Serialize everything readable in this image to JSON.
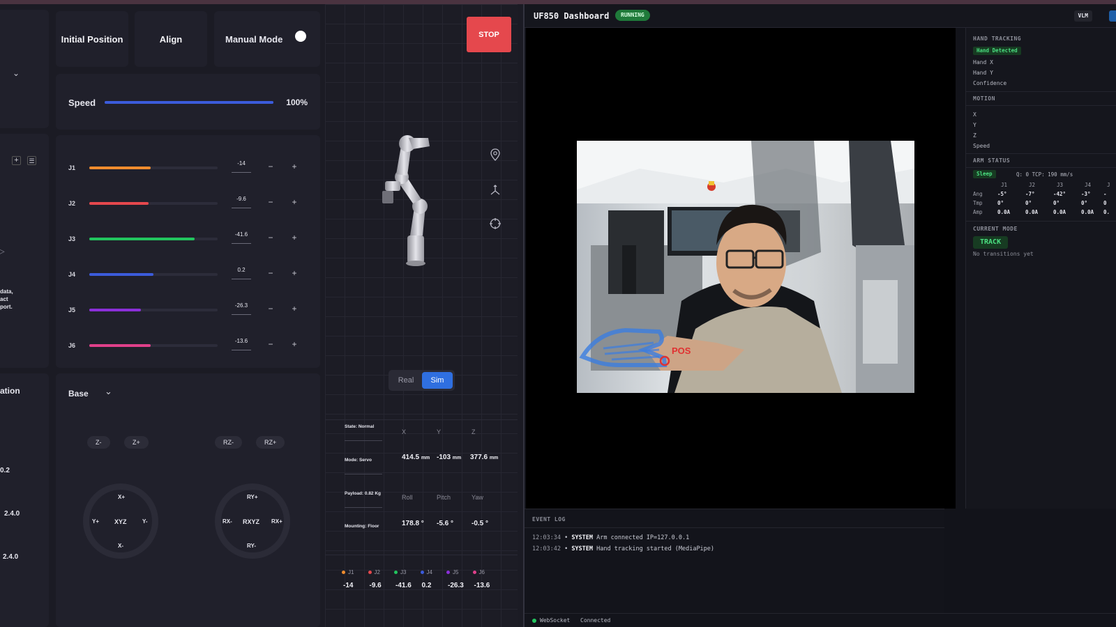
{
  "left_panel": {
    "partial_texts": {
      "dataset_note_lines": [
        "data,",
        "act",
        "port."
      ],
      "section_partial": "ation",
      "version_values": [
        "0.2",
        "2.4.0",
        "2.4.0"
      ]
    },
    "top_buttons": {
      "initial_position": "Initial Position",
      "align": "Align",
      "manual_mode": "Manual Mode"
    },
    "stop": "STOP",
    "speed": {
      "label": "Speed",
      "value_text": "100%",
      "fraction": 1.0
    },
    "joints": [
      {
        "id": "J1",
        "value": "-14",
        "fill": 0.48,
        "color": "#f08c2e"
      },
      {
        "id": "J2",
        "value": "-9.6",
        "fill": 0.46,
        "color": "#e5484d"
      },
      {
        "id": "J3",
        "value": "-41.6",
        "fill": 0.82,
        "color": "#22c55e"
      },
      {
        "id": "J4",
        "value": "0.2",
        "fill": 0.5,
        "color": "#3b5bdb"
      },
      {
        "id": "J5",
        "value": "-26.3",
        "fill": 0.4,
        "color": "#8b2fd9"
      },
      {
        "id": "J6",
        "value": "-13.6",
        "fill": 0.48,
        "color": "#e0408a"
      }
    ],
    "step_minus": "−",
    "step_plus": "+",
    "frame": {
      "label": "Base"
    },
    "jog": {
      "z_minus": "Z-",
      "z_plus": "Z+",
      "rz_minus": "RZ-",
      "rz_plus": "RZ+",
      "xyz": {
        "center": "XYZ",
        "top": "X+",
        "bottom": "X-",
        "left": "Y+",
        "right": "Y-"
      },
      "rxyz": {
        "center": "RXYZ",
        "top": "RY+",
        "bottom": "RY-",
        "left": "RX-",
        "right": "RX+"
      }
    }
  },
  "viz": {
    "mode_toggle": {
      "real": "Real",
      "sim": "Sim",
      "active": "Sim"
    },
    "info": {
      "state": "State: Normal",
      "mode": "Mode: Servo",
      "payload": "Payload: 0.82 Kg",
      "mounting": "Mounting: Floor"
    },
    "position_headers": [
      "X",
      "Y",
      "Z"
    ],
    "position_values": [
      {
        "value": "414.5",
        "unit": "mm"
      },
      {
        "value": "-103",
        "unit": "mm"
      },
      {
        "value": "377.6",
        "unit": "mm"
      }
    ],
    "orientation_headers": [
      "Roll",
      "Pitch",
      "Yaw"
    ],
    "orientation_values": [
      "178.8 °",
      "-5.6 °",
      "-0.5 °"
    ],
    "joint_legend": [
      "J1",
      "J2",
      "J3",
      "J4",
      "J5",
      "J6"
    ],
    "joint_values": [
      "-14",
      "-9.6",
      "-41.6",
      "0.2",
      "-26.3",
      "-13.6"
    ]
  },
  "dashboard": {
    "title": "UF850 Dashboard",
    "status_badge": "RUNNING",
    "vlm_badge": "VLM",
    "camera_overlay": "POS",
    "hand_tracking": {
      "heading": "HAND TRACKING",
      "badge": "Hand Detected",
      "fields": [
        "Hand X",
        "Hand Y",
        "Confidence"
      ]
    },
    "motion": {
      "heading": "MOTION",
      "fields": [
        "X",
        "Y",
        "Z",
        "Speed"
      ]
    },
    "arm_status": {
      "heading": "ARM STATUS",
      "badge": "Sleep",
      "summary": "Q: 0  TCP: 190 mm/s",
      "columns": [
        "J1",
        "J2",
        "J3",
        "J4",
        "J"
      ],
      "rows": [
        {
          "label": "Ang",
          "values": [
            "-5°",
            "-7°",
            "-42°",
            "-3°",
            "-"
          ]
        },
        {
          "label": "Tmp",
          "values": [
            "0°",
            "0°",
            "0°",
            "0°",
            "0"
          ]
        },
        {
          "label": "Amp",
          "values": [
            "0.0A",
            "0.0A",
            "0.0A",
            "0.0A",
            "0."
          ]
        }
      ]
    },
    "current_mode": {
      "heading": "CURRENT MODE",
      "value": "TRACK",
      "note": "No transitions yet"
    },
    "event_log": {
      "heading": "EVENT LOG",
      "entries": [
        {
          "time": "12:03:34",
          "source": "SYSTEM",
          "message": "Arm connected IP=127.0.0.1"
        },
        {
          "time": "12:03:42",
          "source": "SYSTEM",
          "message": "Hand tracking started (MediaPipe)"
        }
      ]
    },
    "status_bar": {
      "label": "WebSocket",
      "state": "Connected"
    }
  }
}
